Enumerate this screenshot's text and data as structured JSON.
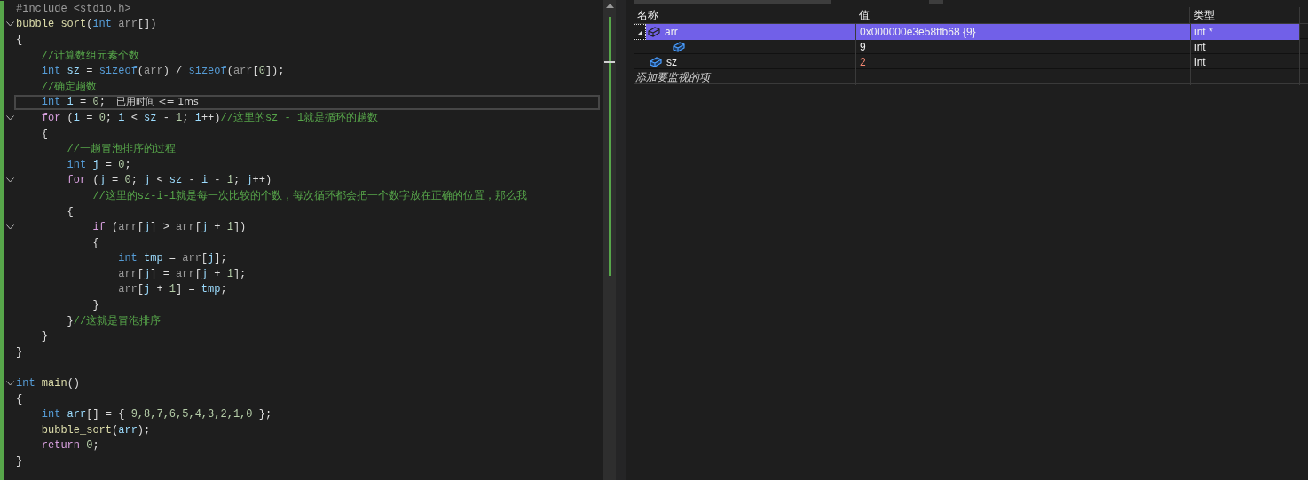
{
  "editor": {
    "lines": [
      {
        "foldable": false,
        "current": false,
        "tokens": [
          {
            "kind": "directive",
            "text": "#include <stdio.h>"
          }
        ]
      },
      {
        "foldable": true,
        "current": false,
        "tokens": [
          {
            "kind": "function",
            "text": "bubble_sort"
          },
          {
            "kind": "plain",
            "text": "("
          },
          {
            "kind": "keyword",
            "text": "int"
          },
          {
            "kind": "param",
            "text": " arr"
          },
          {
            "kind": "plain",
            "text": "[])"
          }
        ]
      },
      {
        "foldable": false,
        "current": false,
        "tokens": [
          {
            "kind": "plain",
            "text": "{"
          }
        ]
      },
      {
        "foldable": false,
        "current": false,
        "tokens": [
          {
            "kind": "comment",
            "text": "    //计算数组元素个数"
          }
        ]
      },
      {
        "foldable": false,
        "current": false,
        "tokens": [
          {
            "kind": "keyword",
            "text": "    int"
          },
          {
            "kind": "variable",
            "text": " sz"
          },
          {
            "kind": "plain",
            "text": " = "
          },
          {
            "kind": "keyword",
            "text": "sizeof"
          },
          {
            "kind": "plain",
            "text": "("
          },
          {
            "kind": "param",
            "text": "arr"
          },
          {
            "kind": "plain",
            "text": ") / "
          },
          {
            "kind": "keyword",
            "text": "sizeof"
          },
          {
            "kind": "plain",
            "text": "("
          },
          {
            "kind": "param",
            "text": "arr"
          },
          {
            "kind": "plain",
            "text": "["
          },
          {
            "kind": "number",
            "text": "0"
          },
          {
            "kind": "plain",
            "text": "]);"
          }
        ]
      },
      {
        "foldable": false,
        "current": false,
        "tokens": [
          {
            "kind": "comment",
            "text": "    //确定趟数"
          }
        ]
      },
      {
        "foldable": false,
        "current": true,
        "hint": "已用时间 <= 1ms",
        "tokens": [
          {
            "kind": "keyword",
            "text": "    int"
          },
          {
            "kind": "variable",
            "text": " i"
          },
          {
            "kind": "plain",
            "text": " = "
          },
          {
            "kind": "number",
            "text": "0"
          },
          {
            "kind": "plain",
            "text": ";"
          }
        ]
      },
      {
        "foldable": true,
        "current": false,
        "tokens": [
          {
            "kind": "control",
            "text": "    for"
          },
          {
            "kind": "plain",
            "text": " ("
          },
          {
            "kind": "variable",
            "text": "i"
          },
          {
            "kind": "plain",
            "text": " = "
          },
          {
            "kind": "number",
            "text": "0"
          },
          {
            "kind": "plain",
            "text": "; "
          },
          {
            "kind": "variable",
            "text": "i"
          },
          {
            "kind": "plain",
            "text": " < "
          },
          {
            "kind": "variable",
            "text": "sz"
          },
          {
            "kind": "plain",
            "text": " - "
          },
          {
            "kind": "number",
            "text": "1"
          },
          {
            "kind": "plain",
            "text": "; "
          },
          {
            "kind": "variable",
            "text": "i"
          },
          {
            "kind": "plain",
            "text": "++)"
          },
          {
            "kind": "comment",
            "text": "//这里的sz - 1就是循环的趟数"
          }
        ]
      },
      {
        "foldable": false,
        "current": false,
        "tokens": [
          {
            "kind": "plain",
            "text": "    {"
          }
        ]
      },
      {
        "foldable": false,
        "current": false,
        "tokens": [
          {
            "kind": "comment",
            "text": "        //一趟冒泡排序的过程"
          }
        ]
      },
      {
        "foldable": false,
        "current": false,
        "tokens": [
          {
            "kind": "keyword",
            "text": "        int"
          },
          {
            "kind": "variable",
            "text": " j"
          },
          {
            "kind": "plain",
            "text": " = "
          },
          {
            "kind": "number",
            "text": "0"
          },
          {
            "kind": "plain",
            "text": ";"
          }
        ]
      },
      {
        "foldable": true,
        "current": false,
        "tokens": [
          {
            "kind": "control",
            "text": "        for"
          },
          {
            "kind": "plain",
            "text": " ("
          },
          {
            "kind": "variable",
            "text": "j"
          },
          {
            "kind": "plain",
            "text": " = "
          },
          {
            "kind": "number",
            "text": "0"
          },
          {
            "kind": "plain",
            "text": "; "
          },
          {
            "kind": "variable",
            "text": "j"
          },
          {
            "kind": "plain",
            "text": " < "
          },
          {
            "kind": "variable",
            "text": "sz"
          },
          {
            "kind": "plain",
            "text": " - "
          },
          {
            "kind": "variable",
            "text": "i"
          },
          {
            "kind": "plain",
            "text": " - "
          },
          {
            "kind": "number",
            "text": "1"
          },
          {
            "kind": "plain",
            "text": "; "
          },
          {
            "kind": "variable",
            "text": "j"
          },
          {
            "kind": "plain",
            "text": "++)"
          }
        ]
      },
      {
        "foldable": false,
        "current": false,
        "tokens": [
          {
            "kind": "comment",
            "text": "            //这里的sz-i-1就是每一次比较的个数，每次循环都会把一个数字放在正确的位置，那么我"
          }
        ]
      },
      {
        "foldable": false,
        "current": false,
        "tokens": [
          {
            "kind": "plain",
            "text": "        {"
          }
        ]
      },
      {
        "foldable": true,
        "current": false,
        "tokens": [
          {
            "kind": "control",
            "text": "            if"
          },
          {
            "kind": "plain",
            "text": " ("
          },
          {
            "kind": "param",
            "text": "arr"
          },
          {
            "kind": "plain",
            "text": "["
          },
          {
            "kind": "variable",
            "text": "j"
          },
          {
            "kind": "plain",
            "text": "] > "
          },
          {
            "kind": "param",
            "text": "arr"
          },
          {
            "kind": "plain",
            "text": "["
          },
          {
            "kind": "variable",
            "text": "j"
          },
          {
            "kind": "plain",
            "text": " + "
          },
          {
            "kind": "number",
            "text": "1"
          },
          {
            "kind": "plain",
            "text": "])"
          }
        ]
      },
      {
        "foldable": false,
        "current": false,
        "tokens": [
          {
            "kind": "plain",
            "text": "            {"
          }
        ]
      },
      {
        "foldable": false,
        "current": false,
        "tokens": [
          {
            "kind": "keyword",
            "text": "                int"
          },
          {
            "kind": "variable",
            "text": " tmp"
          },
          {
            "kind": "plain",
            "text": " = "
          },
          {
            "kind": "param",
            "text": "arr"
          },
          {
            "kind": "plain",
            "text": "["
          },
          {
            "kind": "variable",
            "text": "j"
          },
          {
            "kind": "plain",
            "text": "];"
          }
        ]
      },
      {
        "foldable": false,
        "current": false,
        "tokens": [
          {
            "kind": "param",
            "text": "                arr"
          },
          {
            "kind": "plain",
            "text": "["
          },
          {
            "kind": "variable",
            "text": "j"
          },
          {
            "kind": "plain",
            "text": "] = "
          },
          {
            "kind": "param",
            "text": "arr"
          },
          {
            "kind": "plain",
            "text": "["
          },
          {
            "kind": "variable",
            "text": "j"
          },
          {
            "kind": "plain",
            "text": " + "
          },
          {
            "kind": "number",
            "text": "1"
          },
          {
            "kind": "plain",
            "text": "];"
          }
        ]
      },
      {
        "foldable": false,
        "current": false,
        "tokens": [
          {
            "kind": "param",
            "text": "                arr"
          },
          {
            "kind": "plain",
            "text": "["
          },
          {
            "kind": "variable",
            "text": "j"
          },
          {
            "kind": "plain",
            "text": " + "
          },
          {
            "kind": "number",
            "text": "1"
          },
          {
            "kind": "plain",
            "text": "] = "
          },
          {
            "kind": "variable",
            "text": "tmp"
          },
          {
            "kind": "plain",
            "text": ";"
          }
        ]
      },
      {
        "foldable": false,
        "current": false,
        "tokens": [
          {
            "kind": "plain",
            "text": "            }"
          }
        ]
      },
      {
        "foldable": false,
        "current": false,
        "tokens": [
          {
            "kind": "plain",
            "text": "        }"
          },
          {
            "kind": "comment",
            "text": "//这就是冒泡排序"
          }
        ]
      },
      {
        "foldable": false,
        "current": false,
        "tokens": [
          {
            "kind": "plain",
            "text": "    }"
          }
        ]
      },
      {
        "foldable": false,
        "current": false,
        "tokens": [
          {
            "kind": "plain",
            "text": "}"
          }
        ]
      },
      {
        "foldable": false,
        "current": false
      },
      {
        "foldable": true,
        "current": false,
        "tokens": [
          {
            "kind": "keyword",
            "text": "int"
          },
          {
            "kind": "function",
            "text": " main"
          },
          {
            "kind": "plain",
            "text": "()"
          }
        ]
      },
      {
        "foldable": false,
        "current": false,
        "tokens": [
          {
            "kind": "plain",
            "text": "{"
          }
        ]
      },
      {
        "foldable": false,
        "current": false,
        "tokens": [
          {
            "kind": "keyword",
            "text": "    int"
          },
          {
            "kind": "variable",
            "text": " arr"
          },
          {
            "kind": "plain",
            "text": "[] = { "
          },
          {
            "kind": "number",
            "text": "9,8,7,6,5,4,3,2,1,0"
          },
          {
            "kind": "plain",
            "text": " };"
          }
        ]
      },
      {
        "foldable": false,
        "current": false,
        "tokens": [
          {
            "kind": "function",
            "text": "    bubble_sort"
          },
          {
            "kind": "plain",
            "text": "("
          },
          {
            "kind": "variable",
            "text": "arr"
          },
          {
            "kind": "plain",
            "text": ");"
          }
        ]
      },
      {
        "foldable": false,
        "current": false,
        "tokens": [
          {
            "kind": "control",
            "text": "    return"
          },
          {
            "kind": "number",
            "text": " 0"
          },
          {
            "kind": "plain",
            "text": ";"
          }
        ]
      },
      {
        "foldable": false,
        "current": false,
        "tokens": [
          {
            "kind": "plain",
            "text": "}"
          }
        ]
      }
    ]
  },
  "watch": {
    "columns": [
      "名称",
      "值",
      "类型"
    ],
    "rows": [
      {
        "name": "arr",
        "value": "0x000000e3e58ffb68 {9}",
        "type": "int *",
        "selected": true,
        "changed": false,
        "expanded": true,
        "children": [
          {
            "value": "9",
            "type": "int",
            "selected": false,
            "changed": false
          }
        ]
      },
      {
        "name": "sz",
        "value": "2",
        "type": "int",
        "selected": false,
        "changed": true
      }
    ],
    "add_placeholder": "添加要监视的项"
  }
}
